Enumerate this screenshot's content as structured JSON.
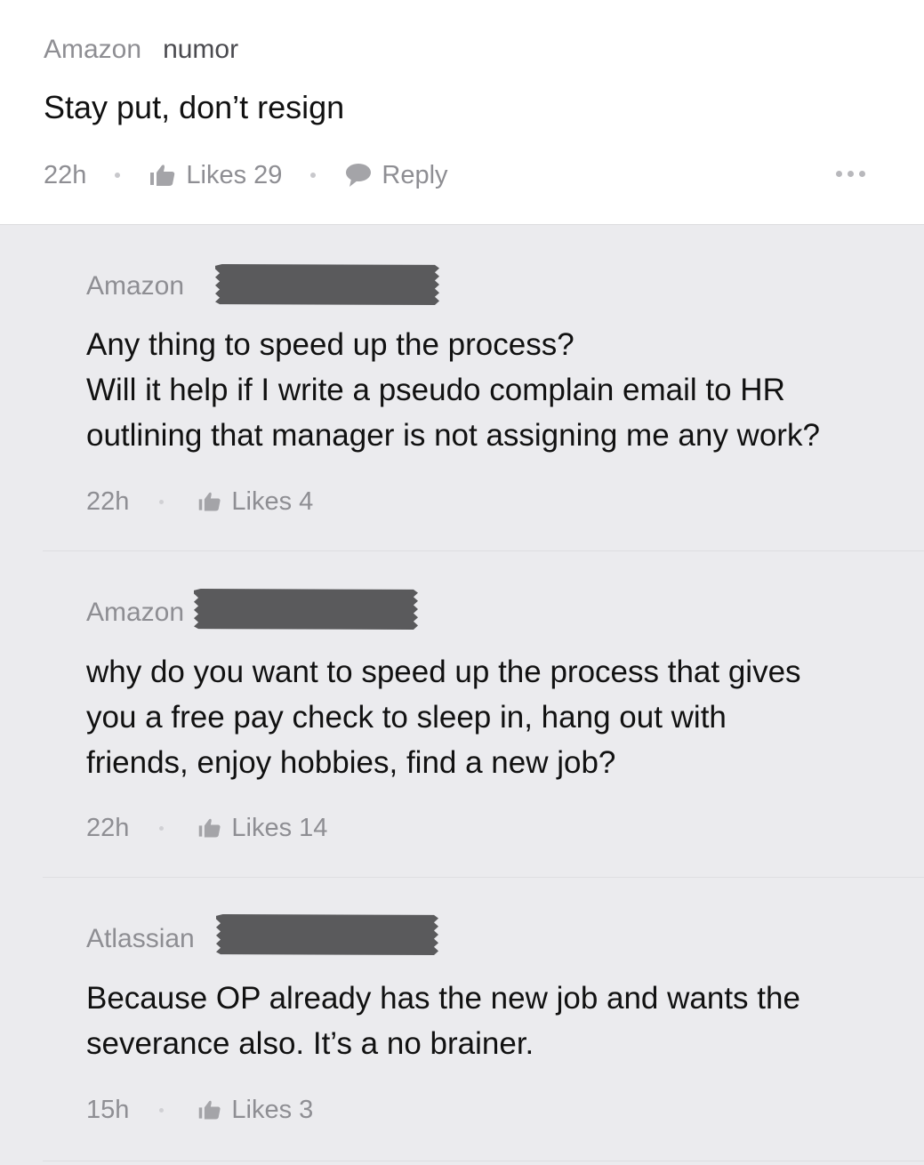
{
  "post": {
    "company": "Amazon",
    "username": "numor",
    "text": "Stay put, don’t resign",
    "time": "22h",
    "likes_label": "Likes 29",
    "reply_label": "Reply"
  },
  "replies": [
    {
      "company": "Amazon",
      "lines": [
        "Any thing to speed up the process?",
        "Will it help if I write a pseudo complain email to HR",
        "outlining that manager is not assigning me any work?"
      ],
      "time": "22h",
      "likes_label": "Likes 4"
    },
    {
      "company": "Amazon",
      "lines": [
        "why do you want to speed up the process that gives",
        "you a free pay check to sleep in, hang out with",
        "friends, enjoy hobbies, find a new job?"
      ],
      "time": "22h",
      "likes_label": "Likes 14"
    },
    {
      "company": "Atlassian",
      "lines": [
        "Because OP already has the new job and wants the",
        "severance also. It’s a no brainer."
      ],
      "time": "15h",
      "likes_label": "Likes 3"
    }
  ],
  "icons": {
    "like": "thumbs-up-icon",
    "reply": "speech-bubble-icon",
    "more": "more-dots-icon"
  },
  "colors": {
    "meta": "#8e8e93",
    "text": "#111111",
    "background": "#ebebee",
    "redaction": "#5a5a5c"
  }
}
